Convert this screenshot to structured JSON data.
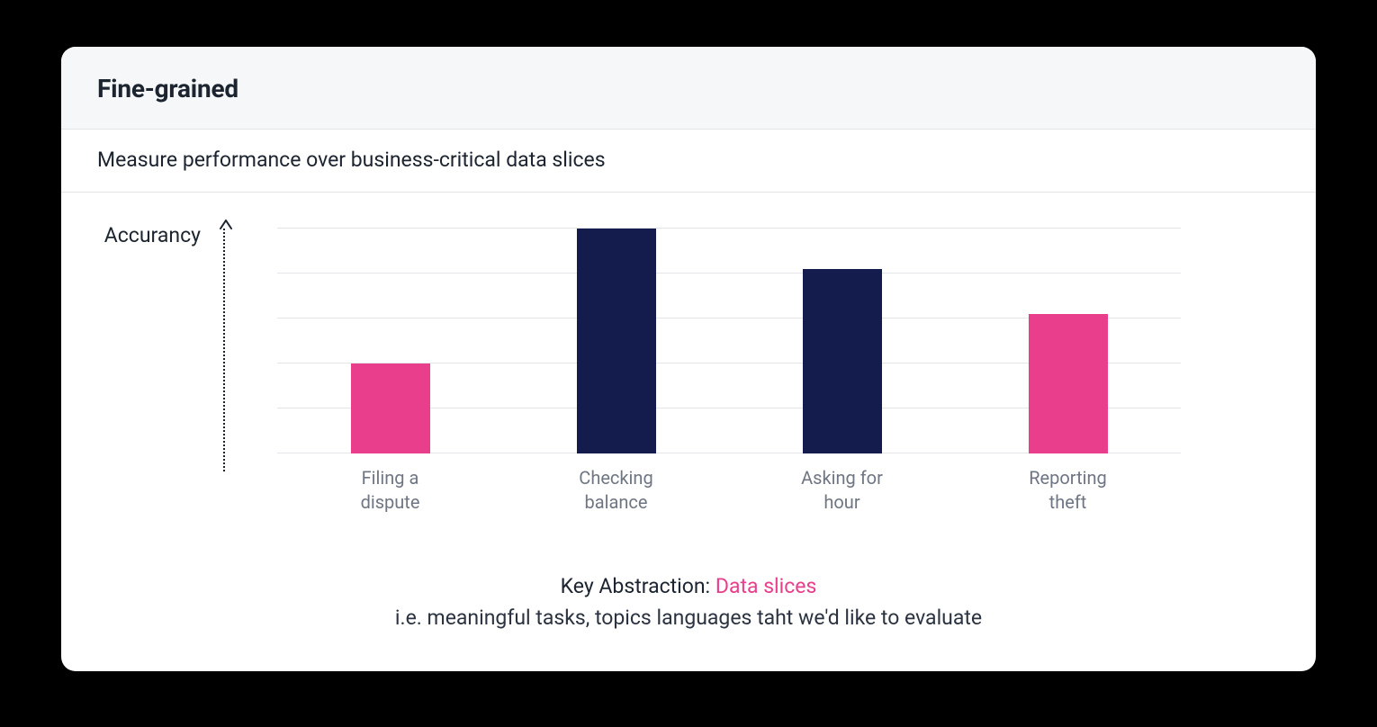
{
  "header": {
    "title": "Fine-grained"
  },
  "subtitle": "Measure performance over business-critical data slices",
  "chart_data": {
    "type": "bar",
    "ylabel": "Accurancy",
    "ylim": [
      0,
      100
    ],
    "grid_count": 6,
    "categories": [
      "Filing a\ndispute",
      "Checking\nbalance",
      "Asking for\nhour",
      "Reporting\ntheft"
    ],
    "values": [
      40,
      100,
      82,
      62
    ],
    "colors": [
      "#e83e8c",
      "#141b4d",
      "#141b4d",
      "#e83e8c"
    ]
  },
  "footer": {
    "prefix": "Key Abstraction: ",
    "highlight": "Data slices",
    "sub": "i.e. meaningful tasks, topics languages taht we'd like to evaluate"
  }
}
